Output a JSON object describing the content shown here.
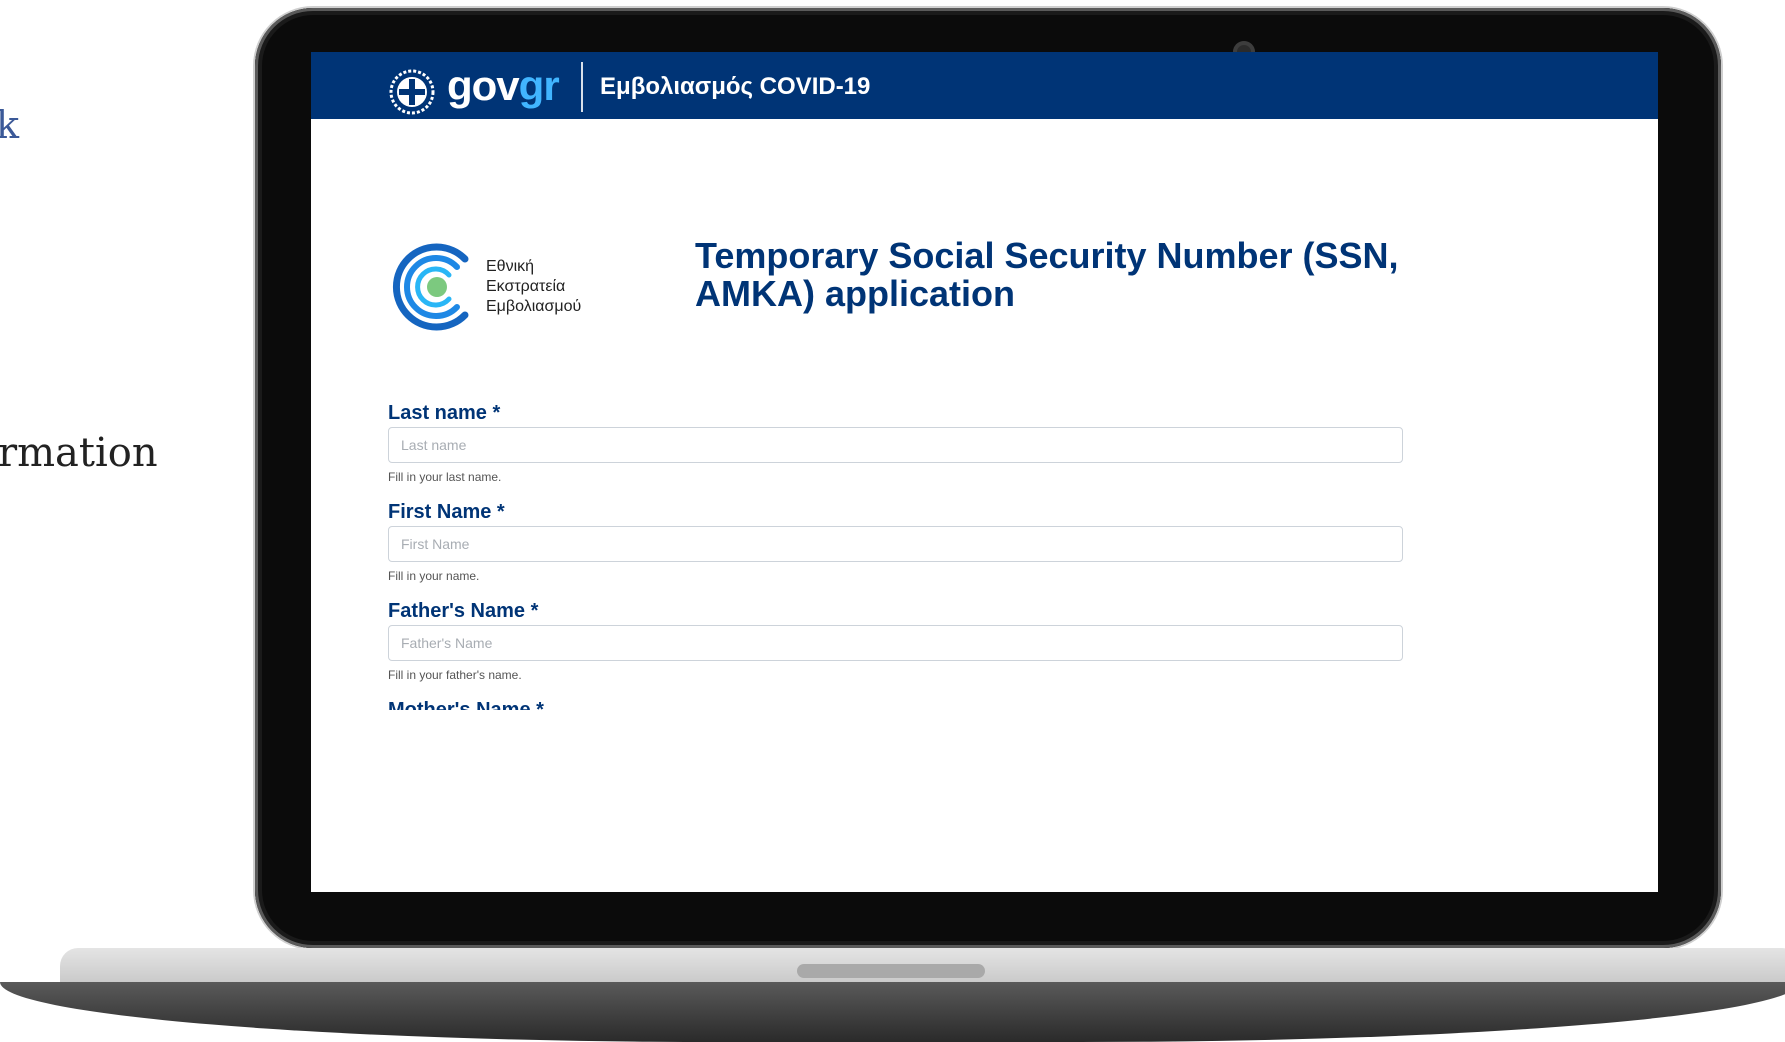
{
  "background_page": {
    "fragment_link": "k",
    "fragment_text": "rmation"
  },
  "header": {
    "brand_gov": "gov",
    "brand_gr": "gr",
    "title": "Εμβολιασμός COVID-19"
  },
  "campaign": {
    "line1": "Εθνική",
    "line2": "Εκστρατεία",
    "line3": "Εμβολιασμού"
  },
  "page": {
    "title": "Temporary Social Security Number (SSN, AMKA) application"
  },
  "form": {
    "fields": [
      {
        "label": "Last name *",
        "placeholder": "Last name",
        "help": "Fill in your last name."
      },
      {
        "label": "First Name *",
        "placeholder": "First Name",
        "help": "Fill in your name."
      },
      {
        "label": "Father's Name *",
        "placeholder": "Father's Name",
        "help": "Fill in your father's name."
      },
      {
        "label": "Mother's Name *"
      }
    ]
  },
  "colors": {
    "header_bg": "#003476",
    "brand_accent": "#41b5ff",
    "label_color": "#003476"
  },
  "icons": {
    "gov_emblem": "greek-coat-of-arms-icon",
    "campaign_logo": "vaccination-campaign-logo"
  }
}
